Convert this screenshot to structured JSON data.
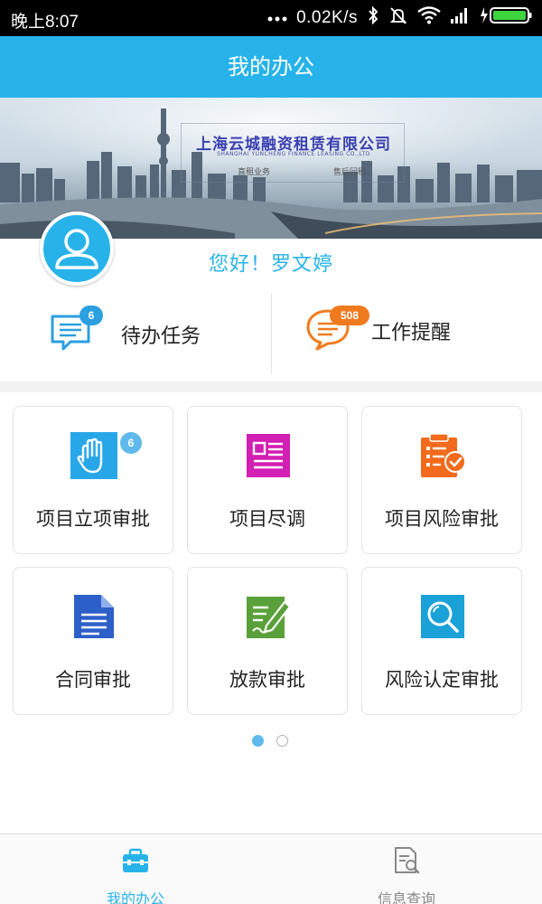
{
  "status_bar": {
    "time": "晚上8:07",
    "network_speed": "0.02K/s",
    "icons": [
      "more-dots-icon",
      "bluetooth-icon",
      "mute-icon",
      "wifi-icon",
      "signal-icon",
      "battery-charging-icon"
    ]
  },
  "header": {
    "title": "我的办公"
  },
  "banner": {
    "company_name": "上海云城融资租赁有限公司",
    "company_name_en": "SHANGHAI YUNCHENG FINANCE LEASING CO.,LTD",
    "tags": [
      "直租业务",
      "售后回租"
    ]
  },
  "user": {
    "greeting": "您好！罗文婷",
    "avatar_icon": "user-avatar-icon"
  },
  "quick_tasks": [
    {
      "label": "待办任务",
      "badge": "6",
      "icon": "chat-list-icon",
      "color": "#2b9fe0"
    },
    {
      "label": "工作提醒",
      "badge": "508",
      "icon": "chat-bubble-icon",
      "color": "#f07b1f"
    }
  ],
  "grid": [
    {
      "label": "项目立项审批",
      "icon": "hand-icon",
      "badge": "6",
      "color": "#27a7e8"
    },
    {
      "label": "项目尽调",
      "icon": "document-lines-icon",
      "color": "#d21fb4"
    },
    {
      "label": "项目风险审批",
      "icon": "clipboard-check-icon",
      "color": "#f26a1b"
    },
    {
      "label": "合同审批",
      "icon": "contract-document-icon",
      "color": "#2d5fc9"
    },
    {
      "label": "放款审批",
      "icon": "edit-note-icon",
      "color": "#5aa03a"
    },
    {
      "label": "风险认定审批",
      "icon": "magnifier-icon",
      "color": "#1aa1d8"
    }
  ],
  "pager": {
    "pages": 2,
    "current": 1
  },
  "bottom_nav": [
    {
      "label": "我的办公",
      "icon": "briefcase-icon",
      "active": true,
      "color": "#27b3ea"
    },
    {
      "label": "信息查询",
      "icon": "document-search-icon",
      "active": false,
      "color": "#888888"
    }
  ]
}
